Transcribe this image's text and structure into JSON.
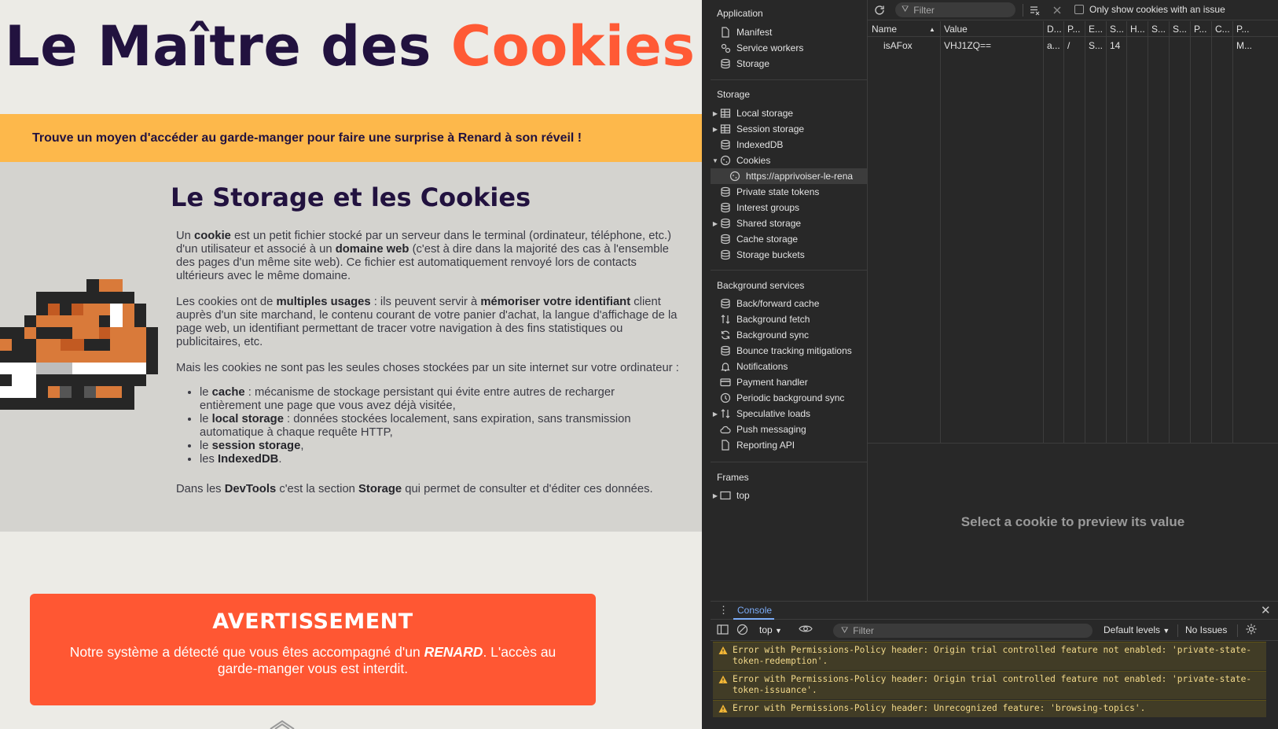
{
  "page": {
    "title_main": "Le Maître des ",
    "title_accent": "Cookies",
    "banner": "Trouve un moyen d'accéder au garde-manger pour faire une surprise à Renard à son réveil !",
    "section_title": "Le Storage et les Cookies",
    "p1": {
      "a": "Un ",
      "b1": "cookie",
      "c": " est un petit fichier stocké par un serveur dans le terminal (ordinateur, téléphone, etc.) d'un utilisateur et associé à un ",
      "b2": "domaine web",
      "d": " (c'est à dire dans la majorité des cas à l'ensemble des pages d'un même site web). Ce fichier est automatiquement renvoyé lors de contacts ultérieurs avec le même domaine."
    },
    "p2": {
      "a": "Les cookies ont de ",
      "b1": "multiples usages",
      "c": " : ils peuvent servir à ",
      "b2": "mémoriser votre identifiant",
      "d": " client auprès d'un site marchand, le contenu courant de votre panier d'achat, la langue d'affichage de la page web, un identifiant permettant de tracer votre navigation à des fins statistiques ou publicitaires, etc."
    },
    "p3": "Mais les cookies ne sont pas les seules choses stockées par un site internet sur votre ordinateur :",
    "list": [
      {
        "pre": "le ",
        "bold": "cache",
        "post": " : mécanisme de stockage persistant qui évite entre autres de recharger entièrement une page que vous avez déjà visitée,"
      },
      {
        "pre": "le ",
        "bold": "local storage",
        "post": " : données stockées localement, sans expiration, sans transmission automatique à chaque requête HTTP,"
      },
      {
        "pre": "le ",
        "bold": "session storage",
        "post": ","
      },
      {
        "pre": "les ",
        "bold": "IndexedDB",
        "post": "."
      }
    ],
    "p4": {
      "a": "Dans les ",
      "b1": "DevTools",
      "c": " c'est la section ",
      "b2": "Storage",
      "d": " qui permet de consulter et d'éditer ces données."
    },
    "warning_title": "AVERTISSEMENT",
    "warning_pre": "Notre système a détecté que vous êtes accompagné d'un ",
    "warning_bold": "RENARD",
    "warning_post": ". L'accès au garde-manger vous est interdit."
  },
  "devtools": {
    "sidebar": {
      "application_title": "Application",
      "application_items": [
        "Manifest",
        "Service workers",
        "Storage"
      ],
      "storage_title": "Storage",
      "storage_items": [
        "Local storage",
        "Session storage",
        "IndexedDB",
        "Cookies",
        "https://apprivoiser-le-rena",
        "Private state tokens",
        "Interest groups",
        "Shared storage",
        "Cache storage",
        "Storage buckets"
      ],
      "bg_title": "Background services",
      "bg_items": [
        "Back/forward cache",
        "Background fetch",
        "Background sync",
        "Bounce tracking mitigations",
        "Notifications",
        "Payment handler",
        "Periodic background sync",
        "Speculative loads",
        "Push messaging",
        "Reporting API"
      ],
      "frames_title": "Frames",
      "frames_items": [
        "top"
      ]
    },
    "toolbar": {
      "filter_placeholder": "Filter",
      "only_issues_label": "Only show cookies with an issue"
    },
    "table": {
      "headers": [
        "Name",
        "Value",
        "D...",
        "P...",
        "E...",
        "S...",
        "H...",
        "S...",
        "S...",
        "P...",
        "C...",
        "P..."
      ],
      "rows": [
        [
          "isAFox",
          "VHJ1ZQ==",
          "a...",
          "/",
          "S...",
          "14",
          "",
          "",
          "",
          "",
          "",
          "M..."
        ]
      ]
    },
    "preview_message": "Select a cookie to preview its value",
    "console": {
      "tab_label": "Console",
      "context": "top",
      "filter_placeholder": "Filter",
      "levels": "Default levels",
      "issues": "No Issues",
      "messages": [
        "Error with Permissions-Policy header: Origin trial controlled feature not enabled: 'private-state-token-redemption'.",
        "Error with Permissions-Policy header: Origin trial controlled feature not enabled: 'private-state-token-issuance'.",
        "Error with Permissions-Policy header: Unrecognized feature: 'browsing-topics'."
      ]
    }
  }
}
